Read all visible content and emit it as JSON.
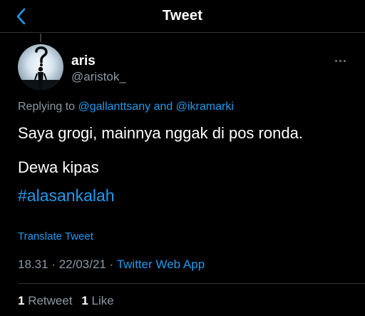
{
  "header": {
    "title": "Tweet",
    "back_icon": "back-chevron-icon"
  },
  "tweet": {
    "author": {
      "name": "aris",
      "handle": "@aristok_",
      "avatar_icon": "question-silhouette-avatar"
    },
    "more_icon": "more-horizontal-icon",
    "replying_to": {
      "prefix": "Replying to",
      "mention_1": "@gallanttsany",
      "conjunction": "and",
      "mention_2": "@ikramarki"
    },
    "text_line_1": "Saya grogi, mainnya nggak di pos ronda.",
    "text_line_2": "Dewa kipas",
    "hashtag": "#alasankalah",
    "translate_label": "Translate Tweet",
    "time": "18.31",
    "date": "22/03/21",
    "separator": "·",
    "source": "Twitter Web App",
    "stats": {
      "retweet_count": "1",
      "retweet_label": "Retweet",
      "like_count": "1",
      "like_label": "Like"
    }
  },
  "colors": {
    "background": "#000000",
    "accent": "#1d9bf0",
    "secondary_text": "#8b98a5",
    "divider": "#2f3336"
  }
}
